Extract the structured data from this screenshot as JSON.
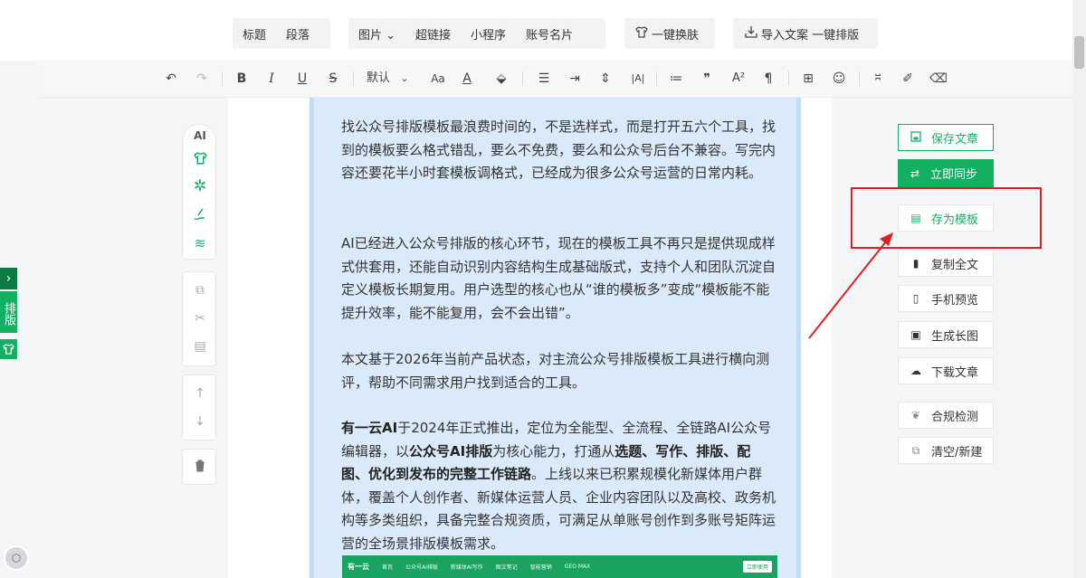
{
  "top_groups": {
    "g1": [
      "标题",
      "段落"
    ],
    "g2": [
      "图片 ⌄",
      "超链接",
      "小程序",
      "账号名片"
    ],
    "skin": "一键换肤",
    "import": "导入文案 一键排版"
  },
  "toolbar": {
    "undo": "↶",
    "redo": "↷",
    "bold": "B",
    "italic": "I",
    "underline": "U",
    "strike": "S",
    "font": "默认",
    "font_arrow": "⌄",
    "case": "Aa",
    "color": "A",
    "highlight": "⬙",
    "align": "☰",
    "indent": "⇥",
    "line_height": "⇕",
    "letter_spacing": "|A|",
    "list": "≔",
    "quote": "❞",
    "superscript": "A²",
    "paragraph": "¶",
    "table": "⊞",
    "emoji": "☺",
    "divider": "⎶",
    "format_brush": "✐",
    "eraser": "⌫"
  },
  "left_tools": {
    "ai": "AI",
    "edge_chevron": "›",
    "edge_label": "排版"
  },
  "article": {
    "p1": "找公众号排版模板最浪费时间的，不是选样式，而是打开五六个工具，找到的模板要么格式错乱，要么不免费，要么和公众号后台不兼容。写完内容还要花半小时套模板调格式，已经成为很多公众号运营的日常内耗。",
    "p2": "AI已经进入公众号排版的核心环节，现在的模板工具不再只是提供现成样式供套用，还能自动识别内容结构生成基础版式，支持个人和团队沉淀自定义模板长期复用。用户选型的核心也从“谁的模板多”变成“模板能不能提升效率，能不能复用，会不会出错”。",
    "p3": "本文基于2026年当前产品状态，对主流公众号排版模板工具进行横向测评，帮助不同需求用户找到适合的工具。",
    "p4": {
      "s1": "有一云AI",
      "s2": "于2024年正式推出，定位为全能型、全流程、全链路AI公众号编辑器，以",
      "s3": "公众号AI排版",
      "s4": "为核心能力，打通从",
      "s5": "选题、写作、排版、配图、优化到发布的完整工作链路",
      "s6": "。上线以来已积累规模化新媒体用户群体，覆盖个人创作者、新媒体运营人员、企业内容团队以及高校、政务机构等多类组织，具备完整合规资质，可满足从单账号创作到多账号矩阵运营的全场景排版模板需求。"
    },
    "banner": {
      "brand": "有一云",
      "nav": [
        "首页",
        "公众号AI排版",
        "新媒体AI写作",
        "图文笔记",
        "智能营销",
        "GEO MAX"
      ],
      "cta": "立即使用"
    }
  },
  "right_actions": {
    "save": "保存文章",
    "sync": "立即同步",
    "save_template": "存为模板",
    "copy_all": "复制全文",
    "mobile_preview": "手机预览",
    "long_image": "生成长图",
    "download": "下载文章",
    "compliance": "合规检测",
    "clear_new": "清空/新建"
  },
  "colors": {
    "accent": "#14b062",
    "annotation": "#e02020",
    "article_bg": "#dbeafb"
  }
}
